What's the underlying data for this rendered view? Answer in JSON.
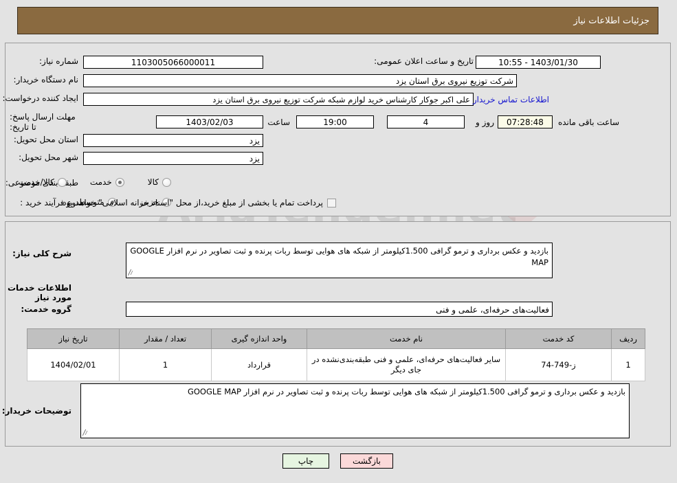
{
  "header": {
    "title": "جزئیات اطلاعات نیاز",
    "bar_color": "#8a6a40"
  },
  "watermark": {
    "text": "AriaTender.net"
  },
  "need_info": {
    "need_number_label": "شماره نیاز:",
    "need_number_value": "1103005066000011",
    "announce_datetime_label": "تاریخ و ساعت اعلان عمومی:",
    "announce_datetime_value": "1403/01/30 - 10:55",
    "buyer_org_label": "نام دستگاه خریدار:",
    "buyer_org_value": "شرکت توزیع نیروی برق استان یزد",
    "requester_label": "ایجاد کننده درخواست:",
    "requester_value": "علی اکبر  جوکار  کارشناس خرید لوازم شبکه  شرکت توزیع نیروی برق استان یزد",
    "buyer_contact_link": "اطلاعات تماس خریدار",
    "deadline_label": "مهلت ارسال پاسخ: تا تاریخ:",
    "deadline_date": "1403/02/03",
    "deadline_hour_label": "ساعت",
    "deadline_hour": "19:00",
    "deadline_days": "4",
    "deadline_days_suffix": "روز و",
    "countdown": "07:28:48",
    "countdown_suffix": "ساعت باقی مانده",
    "province_label": "استان محل تحویل:",
    "province_value": "یزد",
    "city_label": "شهر محل تحویل:",
    "city_value": "یزد",
    "category_label": "طبقه بندی موضوعی:",
    "category_options": [
      {
        "label": "کالا",
        "selected": false
      },
      {
        "label": "خدمت",
        "selected": true
      },
      {
        "label": "کالا/خدمت",
        "selected": false
      }
    ],
    "process_label": "نوع فرآیند خرید :",
    "process_options": [
      {
        "label": "جزیی",
        "selected": false
      },
      {
        "label": "متوسط",
        "selected": true
      }
    ],
    "treasury_checkbox_checked": false,
    "treasury_text": "پرداخت تمام یا بخشی از مبلغ خرید،از محل \"اسناد خزانه اسلامی\" خواهد بود."
  },
  "summary": {
    "label": "شرح کلی نیاز:",
    "value": "بازدید و عکس برداری و ترمو گرافی 1.500کیلومتر از شبکه های هوایی  توسط ربات پرنده و ثبت تصاویر در نرم افزار GOOGLE MAP"
  },
  "services_section": {
    "heading": "اطلاعات خدمات مورد نیاز",
    "group_label": "گروه خدمت:",
    "group_value": "فعالیت‌های حرفه‌ای، علمی و فنی",
    "table": {
      "columns": [
        "ردیف",
        "کد خدمت",
        "نام خدمت",
        "واحد اندازه گیری",
        "تعداد / مقدار",
        "تاریخ نیاز"
      ],
      "rows": [
        {
          "row_no": "1",
          "service_code": "ز-749-74",
          "service_name": "سایر فعالیت‌های حرفه‌ای، علمی و فنی طبقه‌بندی‌نشده در جای دیگر",
          "unit": "قرارداد",
          "quantity": "1",
          "need_date": "1404/02/01"
        }
      ]
    }
  },
  "buyer_notes": {
    "label": "توضیحات خریدار:",
    "value": "بازدید و عکس برداری و ترمو گرافی 1.500کیلومتر از شبکه های هوایی  توسط ربات پرنده و ثبت تصاویر در نرم افزار GOOGLE MAP"
  },
  "footer": {
    "print_label": "چاپ",
    "back_label": "بازگشت"
  }
}
